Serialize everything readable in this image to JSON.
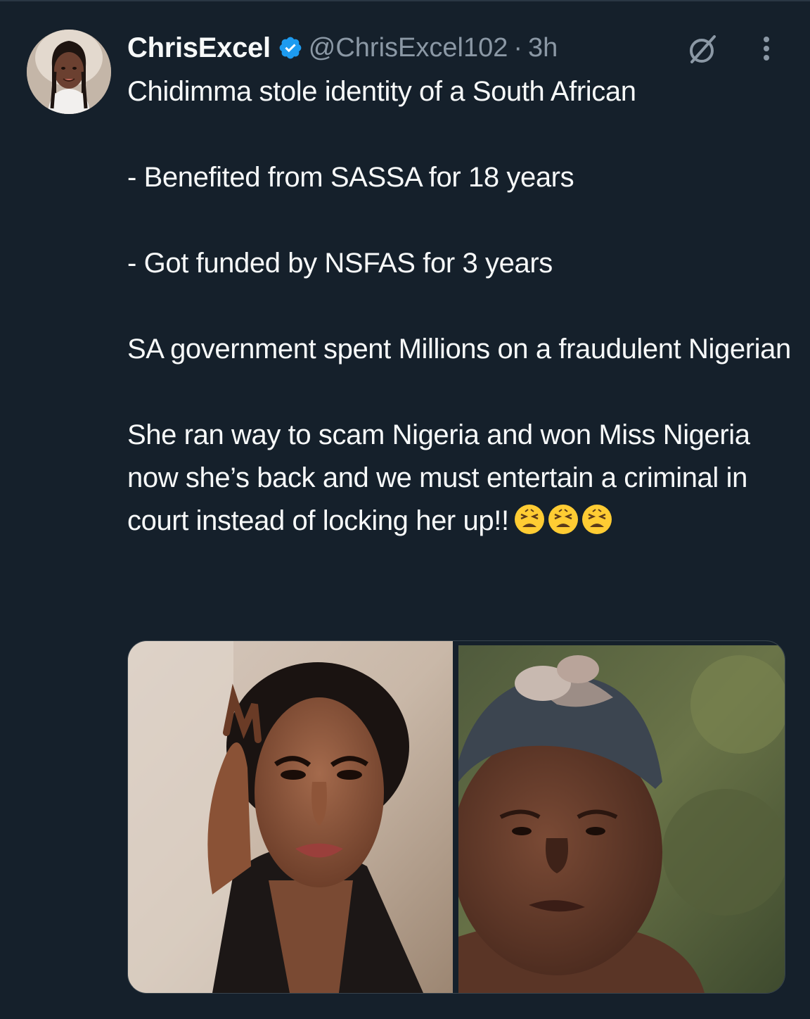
{
  "tweet": {
    "author": {
      "display_name": "ChrisExcel",
      "verified": true,
      "handle": "@ChrisExcel102",
      "separator": "·",
      "time": "3h",
      "avatar": "profile-photo-woman-braids"
    },
    "icons": {
      "grok": "grok-icon",
      "more": "more-vertical-icon",
      "verified": "verified-badge-icon",
      "emoji": "weary-face-emoji"
    },
    "text": {
      "line1": "Chidimma stole identity of a South African",
      "line2": "- Benefited from SASSA for 18 years",
      "line3": "- Got funded by NSFAS for 3 years",
      "line4": "SA government spent Millions on a fraudulent Nigerian",
      "line5": "She ran way to scam Nigeria and won Miss Nigeria now she’s back and we must entertain a criminal in court instead of locking her up!!",
      "emoji_count": 3
    },
    "media": [
      {
        "name": "photo-woman-glam-portrait"
      },
      {
        "name": "photo-woman-headwrap"
      }
    ],
    "colors": {
      "background": "#15202b",
      "text": "#f7f9f9",
      "secondary": "#8b98a5",
      "verified": "#1d9bf0"
    }
  }
}
